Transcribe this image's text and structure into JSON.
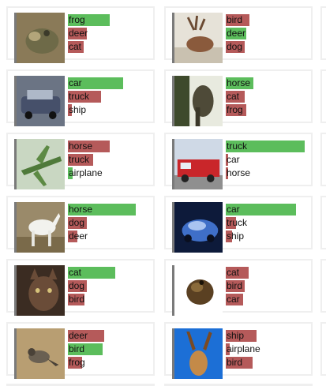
{
  "colors": {
    "correct": "#5cbd5c",
    "incorrect": "#b55a5a",
    "card_border": "#efefef",
    "thumb_border": "#7a7a7a"
  },
  "cards": [
    {
      "image": "frog-photo",
      "preds": [
        {
          "label": "frog",
          "conf": 0.53,
          "correct": true
        },
        {
          "label": "deer",
          "conf": 0.24,
          "correct": false
        },
        {
          "label": "cat",
          "conf": 0.2,
          "correct": false
        }
      ]
    },
    {
      "image": "deer-photo",
      "preds": [
        {
          "label": "bird",
          "conf": 0.3,
          "correct": false
        },
        {
          "label": "deer",
          "conf": 0.26,
          "correct": true
        },
        {
          "label": "dog",
          "conf": 0.24,
          "correct": false
        }
      ]
    },
    {
      "image": "car-photo",
      "preds": [
        {
          "label": "car",
          "conf": 0.7,
          "correct": true
        },
        {
          "label": "truck",
          "conf": 0.42,
          "correct": false
        },
        {
          "label": "ship",
          "conf": 0.05,
          "correct": false
        }
      ]
    },
    {
      "image": "horse-photo",
      "preds": [
        {
          "label": "horse",
          "conf": 0.35,
          "correct": true
        },
        {
          "label": "cat",
          "conf": 0.24,
          "correct": false
        },
        {
          "label": "frog",
          "conf": 0.26,
          "correct": false
        }
      ]
    },
    {
      "image": "airplane-photo",
      "preds": [
        {
          "label": "horse",
          "conf": 0.53,
          "correct": false
        },
        {
          "label": "truck",
          "conf": 0.32,
          "correct": false
        },
        {
          "label": "airplane",
          "conf": 0.06,
          "correct": true
        }
      ]
    },
    {
      "image": "truck-photo",
      "preds": [
        {
          "label": "truck",
          "conf": 1.0,
          "correct": true
        },
        {
          "label": "car",
          "conf": 0.02,
          "correct": false
        },
        {
          "label": "horse",
          "conf": 0.02,
          "correct": false
        }
      ]
    },
    {
      "image": "horse-white-photo",
      "preds": [
        {
          "label": "horse",
          "conf": 0.86,
          "correct": true
        },
        {
          "label": "dog",
          "conf": 0.24,
          "correct": false
        },
        {
          "label": "deer",
          "conf": 0.12,
          "correct": false
        }
      ]
    },
    {
      "image": "car-blue-photo",
      "preds": [
        {
          "label": "car",
          "conf": 0.89,
          "correct": true
        },
        {
          "label": "truck",
          "conf": 0.13,
          "correct": false
        },
        {
          "label": "ship",
          "conf": 0.08,
          "correct": false
        }
      ]
    },
    {
      "image": "cat-photo",
      "preds": [
        {
          "label": "cat",
          "conf": 0.6,
          "correct": true
        },
        {
          "label": "dog",
          "conf": 0.24,
          "correct": false
        },
        {
          "label": "bird",
          "conf": 0.21,
          "correct": false
        }
      ]
    },
    {
      "image": "frog-dark-photo",
      "preds": [
        {
          "label": "cat",
          "conf": 0.29,
          "correct": false
        },
        {
          "label": "bird",
          "conf": 0.24,
          "correct": false
        },
        {
          "label": "car",
          "conf": 0.22,
          "correct": false
        }
      ]
    },
    {
      "image": "bird-photo",
      "preds": [
        {
          "label": "deer",
          "conf": 0.46,
          "correct": false
        },
        {
          "label": "bird",
          "conf": 0.44,
          "correct": true
        },
        {
          "label": "frog",
          "conf": 0.18,
          "correct": false
        }
      ]
    },
    {
      "image": "deer-sky-photo",
      "preds": [
        {
          "label": "ship",
          "conf": 0.39,
          "correct": false
        },
        {
          "label": "airplane",
          "conf": 0.05,
          "correct": false
        },
        {
          "label": "bird",
          "conf": 0.34,
          "correct": false
        }
      ]
    }
  ]
}
